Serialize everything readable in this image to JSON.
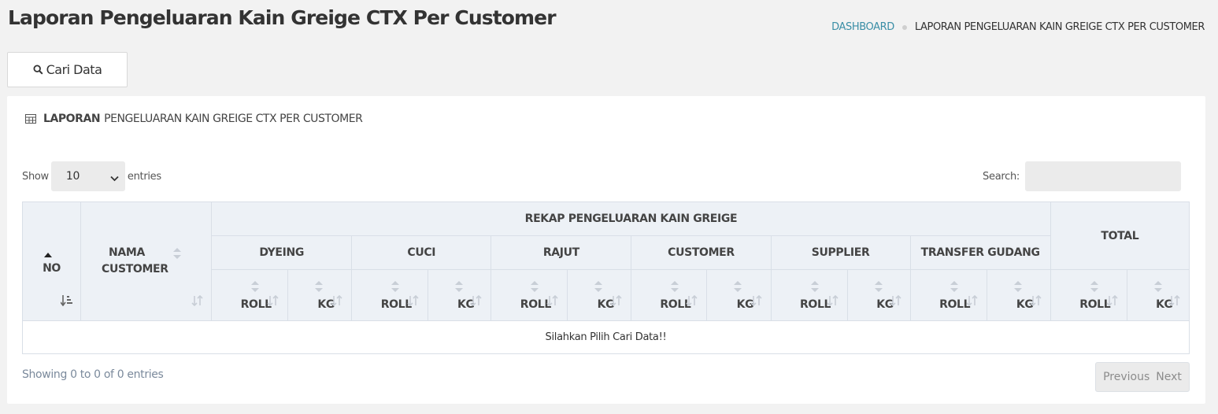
{
  "page": {
    "title": "Laporan Pengeluaran Kain Greige CTX Per Customer"
  },
  "breadcrumb": {
    "home": "DASHBOARD",
    "current": "LAPORAN PENGELUARAN KAIN GREIGE CTX PER CUSTOMER"
  },
  "toolbar": {
    "search_button_label": "Cari Data",
    "search_icon": "search-icon"
  },
  "panel": {
    "icon": "table-icon",
    "title_bold": "LAPORAN",
    "title_rest": "PENGELUARAN KAIN GREIGE CTX PER CUSTOMER"
  },
  "datatable": {
    "length_prefix": "Show",
    "length_value": "10",
    "length_suffix": "entries",
    "search_label": "Search:",
    "search_value": "",
    "empty_message": "Silahkan Pilih Cari Data!!",
    "info": "Showing 0 to 0 of 0 entries",
    "prev_label": "Previous",
    "next_label": "Next"
  },
  "table": {
    "col_no": "NO",
    "col_customer_line1": "NAMA",
    "col_customer_line2": "CUSTOMER",
    "group_header": "REKAP PENGELUARAN KAIN GREIGE",
    "total_header": "TOTAL",
    "groups": [
      "DYEING",
      "CUCI",
      "RAJUT",
      "CUSTOMER",
      "SUPPLIER",
      "TRANSFER GUDANG"
    ],
    "sub_roll": "ROLL",
    "sub_kg": "KG"
  },
  "colors": {
    "link": "#3a8ea6",
    "header_bg": "#edf1f6",
    "page_bg": "#f2f2f2"
  }
}
